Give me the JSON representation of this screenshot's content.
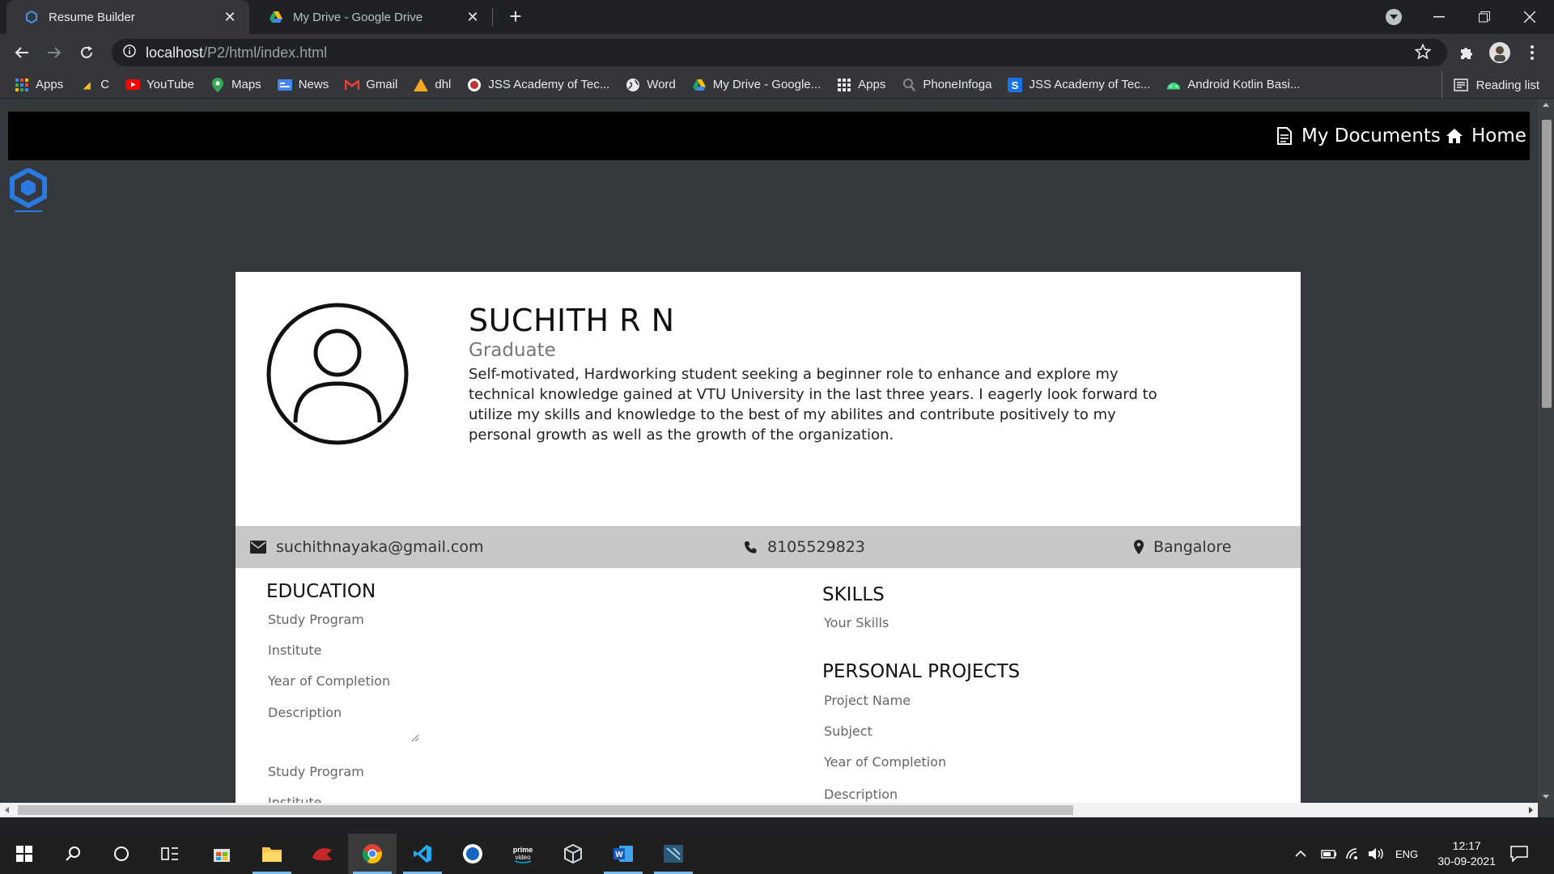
{
  "browser": {
    "tabs": [
      {
        "title": "Resume Builder",
        "active": true
      },
      {
        "title": "My Drive - Google Drive",
        "active": false
      }
    ],
    "url_host": "localhost",
    "url_path": "/P2/html/index.html",
    "bookmarks": [
      {
        "label": "Apps",
        "icon": "apps-grid-icon"
      },
      {
        "label": "C",
        "icon": "c-icon"
      },
      {
        "label": "YouTube",
        "icon": "youtube-icon"
      },
      {
        "label": "Maps",
        "icon": "maps-pin-icon"
      },
      {
        "label": "News",
        "icon": "news-icon"
      },
      {
        "label": "Gmail",
        "icon": "gmail-icon"
      },
      {
        "label": "dhl",
        "icon": "dhl-icon"
      },
      {
        "label": "JSS Academy of Tec...",
        "icon": "jss-icon"
      },
      {
        "label": "Word",
        "icon": "globe-icon"
      },
      {
        "label": "My Drive - Google...",
        "icon": "drive-icon"
      },
      {
        "label": "Apps",
        "icon": "apps-grid-icon"
      },
      {
        "label": "PhoneInfoga",
        "icon": "phoneinfoga-icon"
      },
      {
        "label": "JSS Academy of Tec...",
        "icon": "jss-s-icon"
      },
      {
        "label": "Android Kotlin Basi...",
        "icon": "android-icon"
      }
    ],
    "reading_list": "Reading list"
  },
  "site": {
    "nav": {
      "my_documents": "My Documents",
      "home": "Home"
    },
    "profile": {
      "name": "SUCHITH R N",
      "role": "Graduate",
      "summary": "Self-motivated, Hardworking student seeking a beginner role to enhance and explore my technical knowledge gained at VTU University in the last three years. I eagerly look forward to utilize my skills and knowledge to the best of my abilites and contribute positively to my personal growth as well as the growth of the organization."
    },
    "contact": {
      "email": "suchithnayaka@gmail.com",
      "phone": "8105529823",
      "location": "Bangalore"
    },
    "education": {
      "title": "EDUCATION",
      "fields": [
        "Study Program",
        "Institute",
        "Year of Completion",
        "Description",
        "Study Program",
        "Institute"
      ]
    },
    "skills": {
      "title": "SKILLS",
      "placeholder": "Your Skills"
    },
    "projects": {
      "title": "PERSONAL PROJECTS",
      "fields": [
        "Project Name",
        "Subject",
        "Year of Completion",
        "Description"
      ]
    }
  },
  "taskbar": {
    "language": "ENG",
    "time": "12:17",
    "date": "30-09-2021"
  }
}
